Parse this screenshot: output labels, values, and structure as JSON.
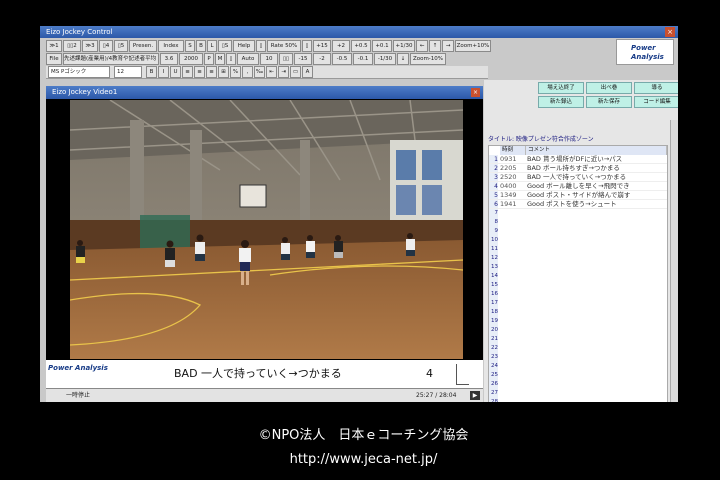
{
  "control_window": {
    "title": "Eizo Jockey Control",
    "close": "×",
    "row1": [
      "≫1",
      "▯▯2",
      "≫3",
      "▯4",
      "▯5",
      "Presen.",
      "Index",
      "S",
      "B",
      "L",
      "▯S",
      "Help",
      "▯",
      "Rate 50%",
      "▯",
      "+15",
      "+2",
      "+0.5",
      "+0.1",
      "+1/30",
      "←",
      "↑",
      "→",
      "Zoom+10%"
    ],
    "row2": [
      "File",
      "先述課題(産業用)/4教育や記述者平均 ree",
      "3.6",
      "2000",
      "P",
      "M",
      "▯",
      "Auto",
      "10",
      "▯▯",
      "-15",
      "-2",
      "-0.5",
      "-0.1",
      "-1/30",
      "↓",
      "Zoom-10%"
    ],
    "logo": "Power Analysis"
  },
  "format_bar": {
    "font": "MS Pゴシック",
    "size": "12",
    "buttons": [
      "B",
      "I",
      "U",
      "≡",
      "≡",
      "≡",
      "⊞",
      "%",
      ",",
      "‰",
      "⇤",
      "⇥",
      "▭",
      "A"
    ]
  },
  "video_window": {
    "title": "Eizo Jockey Video1",
    "close": "×",
    "logo": "Power Analysis",
    "caption": "BAD 一人で持っていく→つかまる",
    "caption_number": "4",
    "status_left": "一時停止",
    "timecode": "25:27 / 28:04"
  },
  "code_panel": {
    "buttons": [
      "場え込終了",
      "出べ巻",
      "導る",
      "新た録込",
      "新た保存",
      "コード編集"
    ],
    "title_line": "タイトル: 映像プレゼン符合作成ゾーン",
    "col_headers": [
      "時刻",
      "コメント"
    ],
    "rows": [
      {
        "n": "1",
        "code": "0931",
        "text": "BAD 貰う場所がDFに近い→パス"
      },
      {
        "n": "2",
        "code": "2205",
        "text": "BAD ボール持ちすぎ→つかまる"
      },
      {
        "n": "3",
        "code": "2520",
        "text": "BAD 一人で持っていく→つかまる"
      },
      {
        "n": "4",
        "code": "0400",
        "text": "Good ボール離しを早く→飛閃でき"
      },
      {
        "n": "5",
        "code": "1349",
        "text": "Good ポスト・サイドが絡んで崩す"
      },
      {
        "n": "6",
        "code": "1941",
        "text": "Good ポストを使う→シュート"
      }
    ],
    "empty_row_numbers": [
      "7",
      "8",
      "9",
      "10",
      "11",
      "12",
      "13",
      "14",
      "15",
      "16",
      "17",
      "18",
      "19",
      "20",
      "21",
      "22",
      "23",
      "24",
      "25",
      "26",
      "27",
      "28"
    ]
  },
  "footer": {
    "org": "©NPO法人　日本ｅコーチング協会",
    "url": "http://www.jeca-net.jp/"
  }
}
